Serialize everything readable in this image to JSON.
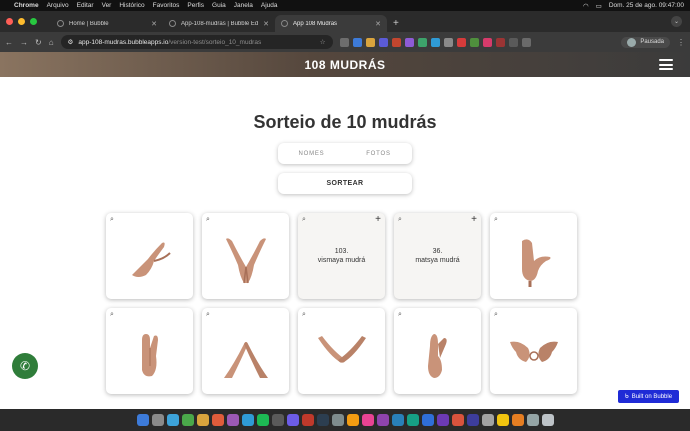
{
  "menubar": {
    "app": "Chrome",
    "items": [
      "Arquivo",
      "Editar",
      "Ver",
      "Histórico",
      "Favoritos",
      "Perfis",
      "Guia",
      "Janela",
      "Ajuda"
    ],
    "clock": "Dom. 25 de ago. 09:47:00"
  },
  "tabs": [
    {
      "title": "Home | Bubble"
    },
    {
      "title": "App-108-mudras | Bubble Editor"
    },
    {
      "title": "App 108 Mudras"
    }
  ],
  "toolbar": {
    "url_host": "app-108-mudras.bubbleapps.io",
    "url_path": "/version-test/sorteio_10_mudras",
    "profile": "Pausada"
  },
  "site": {
    "logo": "108 MUDRÁS",
    "heading": "Sorteio de 10 mudrás",
    "toggle": {
      "left": "NOMES",
      "right": "FOTOS"
    },
    "draw_button": "SORTEAR",
    "built_on": "Built on Bubble"
  },
  "cards": [
    {
      "type": "image",
      "icon": "hand-pose-1"
    },
    {
      "type": "image",
      "icon": "hand-pose-2"
    },
    {
      "type": "text",
      "number": "103.",
      "name": "vismaya mudrá"
    },
    {
      "type": "text",
      "number": "36.",
      "name": "matsya mudrá"
    },
    {
      "type": "image",
      "icon": "hand-pose-5"
    },
    {
      "type": "image",
      "icon": "hand-pose-6"
    },
    {
      "type": "image",
      "icon": "hand-pose-7"
    },
    {
      "type": "image",
      "icon": "hand-pose-8"
    },
    {
      "type": "image",
      "icon": "hand-pose-9"
    },
    {
      "type": "image",
      "icon": "hand-pose-10"
    }
  ],
  "colors": {
    "skin": "#c99379",
    "skin_dark": "#a87058",
    "accent": "#1f2bd6",
    "whatsapp": "#2f7d3a"
  }
}
